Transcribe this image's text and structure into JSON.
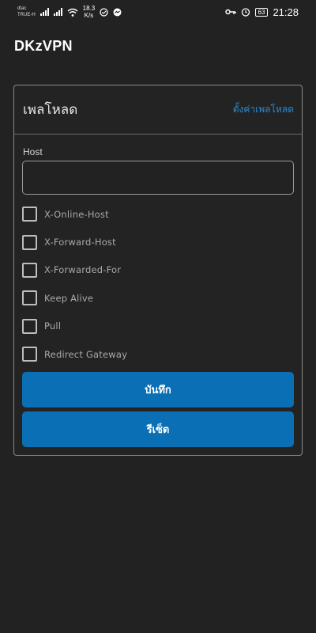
{
  "status_bar": {
    "carrier_line1": "dtac",
    "carrier_line2": "TRUE-H",
    "speed_value": "18.3",
    "speed_unit": "K/s",
    "battery": "63",
    "time": "21:28"
  },
  "app": {
    "title": "DKzVPN"
  },
  "payload_card": {
    "title": "เพลโหลด",
    "settings_link": "ตั้งค่าเพลโหลด",
    "host_label": "Host",
    "host_value": "",
    "options": [
      {
        "label": "X-Online-Host",
        "checked": false
      },
      {
        "label": "X-Forward-Host",
        "checked": false
      },
      {
        "label": "X-Forwarded-For",
        "checked": false
      },
      {
        "label": "Keep Alive",
        "checked": false
      },
      {
        "label": "Pull",
        "checked": false
      },
      {
        "label": "Redirect Gateway",
        "checked": false
      }
    ],
    "save_label": "บันทึก",
    "reset_label": "รีเซ็ต"
  },
  "colors": {
    "background": "#222222",
    "accent": "#0a6fb5",
    "link": "#2b8ad0"
  }
}
